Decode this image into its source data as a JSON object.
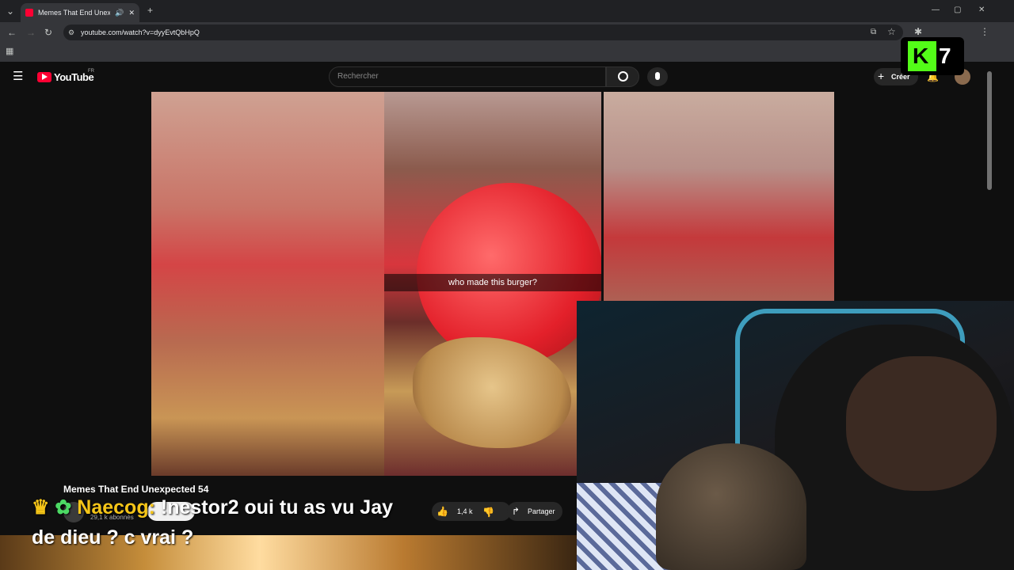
{
  "browser": {
    "tab_title": "Memes That End Unexpecte",
    "new_tab": "+",
    "url": "youtube.com/watch?v=dyyEvtQbHpQ",
    "window_controls": [
      "—",
      "▢",
      "✕"
    ]
  },
  "youtube": {
    "logo": "YouTube",
    "region": "FR",
    "search_placeholder": "Rechercher",
    "create_label": "Créer"
  },
  "video": {
    "caption": "who made this burger?",
    "title": "Memes That End Unexpected 54",
    "subscribers": "29,1 k abonnés",
    "likes": "1,4 k",
    "share_label": "Partager"
  },
  "stream_overlay": {
    "chat_username": "Naecog",
    "chat_message": "!nestor2 oui tu as vu Jay de dieu ? c vrai ?",
    "badge_count": "7",
    "badge_logo": "K"
  },
  "icons": [
    "youtube-tab-icon",
    "back-icon",
    "forward-icon",
    "reload-icon",
    "site-info-icon",
    "install-icon",
    "star-icon",
    "extensions-icon",
    "apps-icon",
    "menu-icon",
    "search-icon",
    "mic-icon",
    "plus-icon",
    "bell-icon",
    "like-icon",
    "dislike-icon",
    "share-icon",
    "crown-icon"
  ]
}
